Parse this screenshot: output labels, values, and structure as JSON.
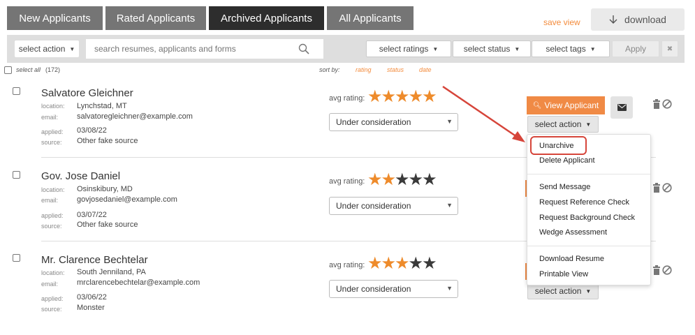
{
  "tabs": [
    {
      "label": "New Applicants"
    },
    {
      "label": "Rated Applicants"
    },
    {
      "label": "Archived Applicants"
    },
    {
      "label": "All Applicants"
    }
  ],
  "header": {
    "save_view": "save view",
    "download": "download"
  },
  "toolbar": {
    "select_action": "select action",
    "search_placeholder": "search resumes, applicants and forms",
    "select_ratings": "select ratings",
    "select_status": "select status",
    "select_tags": "select tags",
    "apply": "Apply",
    "clear_icon": "✖"
  },
  "list_header": {
    "select_all": "select all",
    "count": "(172)",
    "sort_by": "sort by:",
    "sort_rating": "rating",
    "sort_status": "status",
    "sort_date": "date"
  },
  "labels": {
    "location": "location:",
    "email": "email:",
    "applied": "applied:",
    "source": "source:",
    "avg_rating": "avg rating:",
    "view_applicant": "View Applicant",
    "select_action": "select action"
  },
  "applicants": [
    {
      "name": "Salvatore Gleichner",
      "location": "Lynchstad, MT",
      "email": "salvatoregleichner@example.com",
      "applied": "03/08/22",
      "source": "Other fake source",
      "rating": 5,
      "status": "Under consideration"
    },
    {
      "name": "Gov. Jose Daniel",
      "location": "Osinskibury, MD",
      "email": "govjosedaniel@example.com",
      "applied": "03/07/22",
      "source": "Other fake source",
      "rating": 2,
      "status": "Under consideration"
    },
    {
      "name": "Mr. Clarence Bechtelar",
      "location": "South Jenniland, PA",
      "email": "mrclarencebechtelar@example.com",
      "applied": "03/06/22",
      "source": "Monster",
      "rating": 3,
      "status": "Under consideration"
    }
  ],
  "action_menu": {
    "items": [
      "Unarchive",
      "Delete Applicant",
      "Send Message",
      "Request Reference Check",
      "Request Background Check",
      "Wedge Assessment",
      "Download Resume",
      "Printable View"
    ]
  },
  "colors": {
    "accent": "#f08a45",
    "star": "#ee8b2b",
    "tab_active": "#2d2d2d",
    "highlight": "#d6453a"
  }
}
